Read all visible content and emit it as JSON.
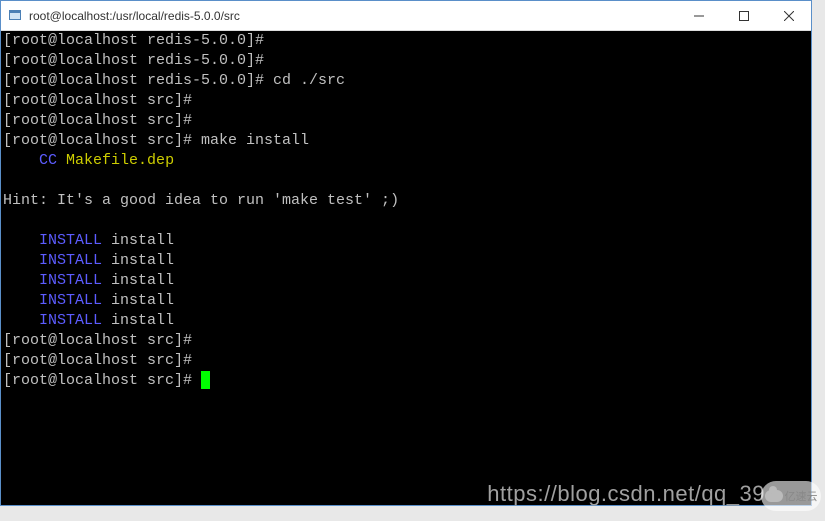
{
  "window": {
    "title": "root@localhost:/usr/local/redis-5.0.0/src"
  },
  "terminal": {
    "lines": [
      {
        "prompt": "[root@localhost redis-5.0.0]#",
        "cmd": ""
      },
      {
        "prompt": "[root@localhost redis-5.0.0]#",
        "cmd": ""
      },
      {
        "prompt": "[root@localhost redis-5.0.0]#",
        "cmd": " cd ./src"
      },
      {
        "prompt": "[root@localhost src]#",
        "cmd": ""
      },
      {
        "prompt": "[root@localhost src]#",
        "cmd": ""
      },
      {
        "prompt": "[root@localhost src]#",
        "cmd": " make install"
      }
    ],
    "cc_label": "CC",
    "cc_file": "Makefile.dep",
    "hint": "Hint: It's a good idea to run 'make test' ;)",
    "install_label": "INSTALL",
    "install_word": "install",
    "tail_prompts": [
      "[root@localhost src]#",
      "[root@localhost src]#",
      "[root@localhost src]# "
    ]
  },
  "watermark": {
    "url": "https://blog.csdn.net/qq_39",
    "logo": "亿速云"
  }
}
